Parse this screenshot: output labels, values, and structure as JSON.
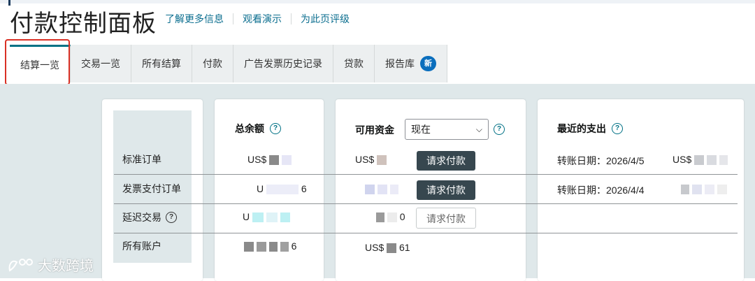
{
  "page": {
    "title": "付款控制面板",
    "links": [
      "了解更多信息",
      "观看演示",
      "为此页评级"
    ]
  },
  "tabs": [
    {
      "label": "结算一览"
    },
    {
      "label": "交易一览"
    },
    {
      "label": "所有结算"
    },
    {
      "label": "付款"
    },
    {
      "label": "广告发票历史记录"
    },
    {
      "label": "贷款"
    },
    {
      "label": "报告库",
      "badge": "新"
    }
  ],
  "row_labels": {
    "standard": "标准订单",
    "invoice": "发票支付订单",
    "deferred": "延迟交易",
    "all": "所有账户"
  },
  "total_balance": {
    "title": "总余额",
    "standard": "US$",
    "invoice": "U",
    "invoice_tail": "6",
    "deferred": "U",
    "all_tail": "6"
  },
  "available_funds": {
    "title": "可用资金",
    "select_value": "现在",
    "standard": "US$",
    "deferred_tail": "0",
    "all_prefix": "US$",
    "all_tail": "61",
    "button_request": "请求付款"
  },
  "recent_payouts": {
    "title": "最近的支出",
    "rows": [
      {
        "label": "转账日期：2026/4/5",
        "amount": "US$"
      },
      {
        "label": "转账日期：2026/4/4",
        "amount": ""
      }
    ]
  },
  "icons": {
    "help": "help-circle-icon",
    "chevron": "chevron-down-icon"
  },
  "colors": {
    "accent": "#007185",
    "dark_button": "#37474f",
    "badge": "#0a6ebd",
    "background": "#dfe8ea"
  },
  "watermark": "大数跨境"
}
